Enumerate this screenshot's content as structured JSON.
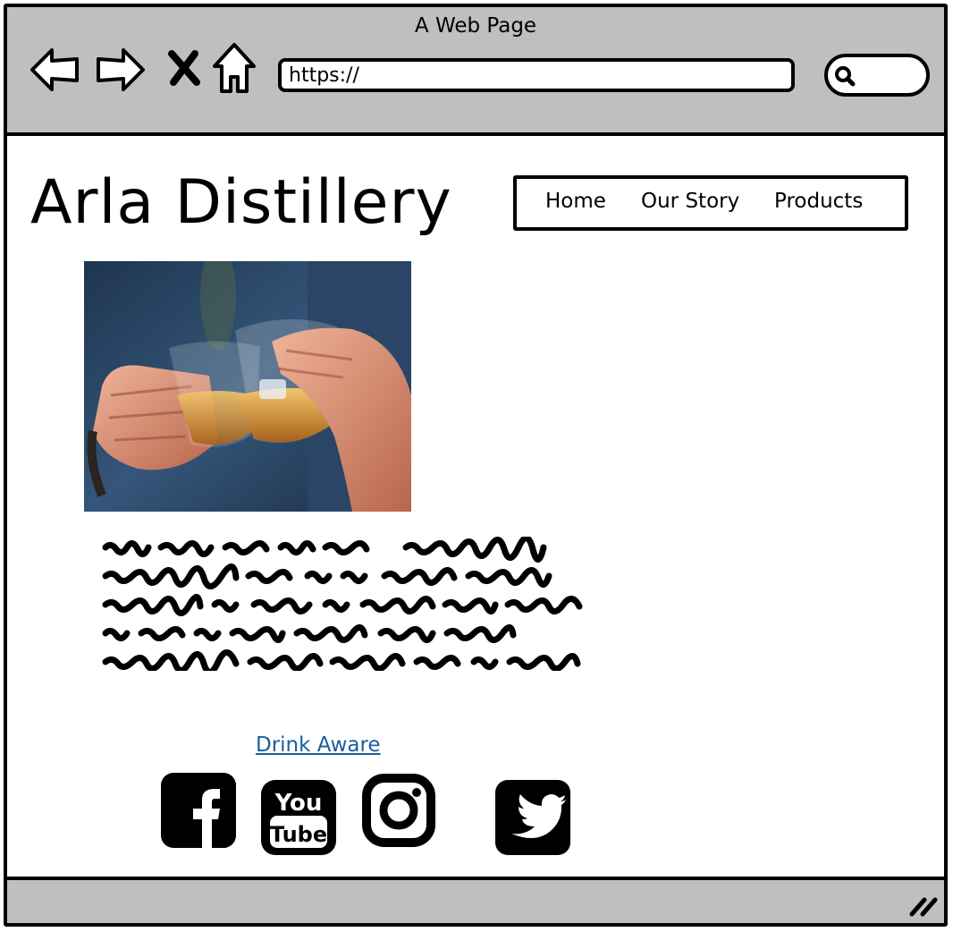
{
  "window": {
    "title": "A Web Page"
  },
  "address_bar": {
    "url": "https://"
  },
  "site": {
    "name": "Arla Distillery"
  },
  "nav": {
    "items": [
      "Home",
      "Our Story",
      "Products"
    ]
  },
  "footer": {
    "link_label": "Drink Aware"
  },
  "social": [
    "facebook-icon",
    "youtube-icon",
    "instagram-icon",
    "twitter-icon"
  ],
  "hero": {
    "image": "photo of two hands clinking whisky glasses"
  },
  "colors": {
    "chrome": "#bfbfbf",
    "link": "#1a5d9c",
    "ink": "#000000"
  }
}
